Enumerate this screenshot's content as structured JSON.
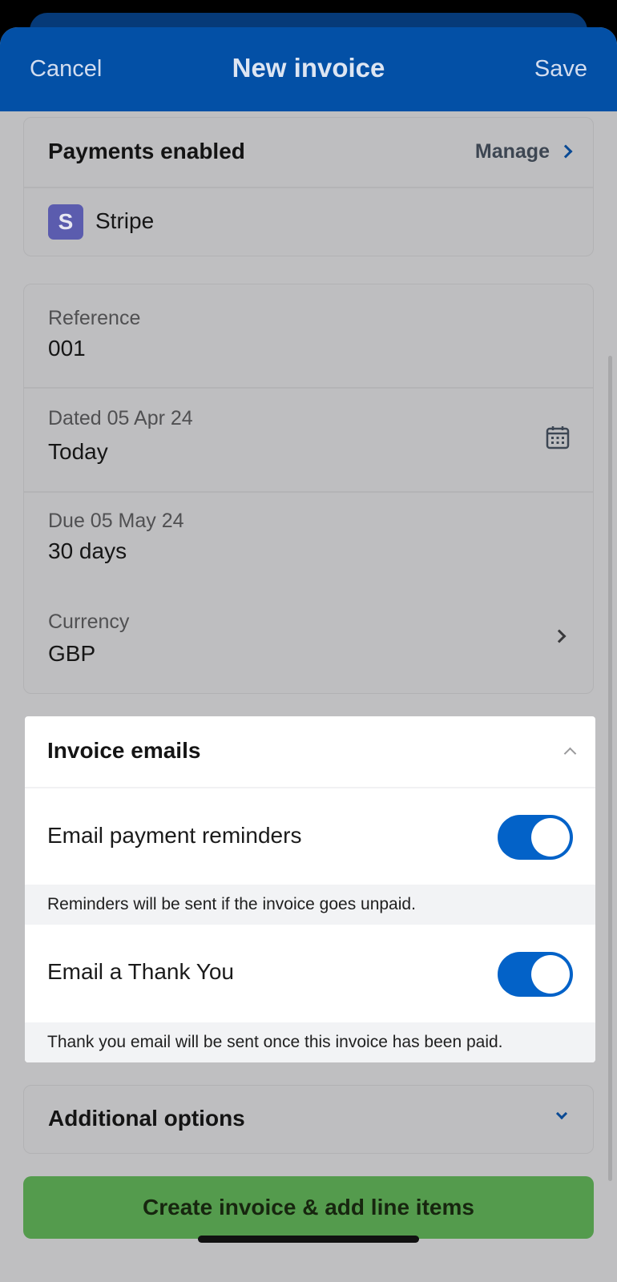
{
  "navbar": {
    "cancel_label": "Cancel",
    "title": "New invoice",
    "save_label": "Save"
  },
  "payments": {
    "title": "Payments enabled",
    "manage_label": "Manage",
    "provider_initial": "S",
    "provider_name": "Stripe"
  },
  "details": {
    "reference": {
      "label": "Reference",
      "value": "001"
    },
    "dated": {
      "label": "Dated 05 Apr 24",
      "value": "Today",
      "icon": "calendar-icon"
    },
    "due": {
      "label": "Due 05 May 24",
      "value": "30 days"
    },
    "currency": {
      "label": "Currency",
      "value": "GBP"
    }
  },
  "invoice_emails": {
    "title": "Invoice emails",
    "reminders": {
      "label": "Email payment reminders",
      "enabled": true,
      "helper": "Reminders will be sent if the invoice goes unpaid."
    },
    "thank_you": {
      "label": "Email a Thank You",
      "enabled": true,
      "helper": "Thank you email will be sent once this invoice has been paid."
    }
  },
  "additional_options": {
    "title": "Additional options"
  },
  "create_button": {
    "label": "Create invoice & add line items"
  },
  "colors": {
    "brand_blue": "#0350a6",
    "toggle_on": "#0362c8",
    "create_green": "#549b4d",
    "stripe_purple": "#5b5cae"
  }
}
